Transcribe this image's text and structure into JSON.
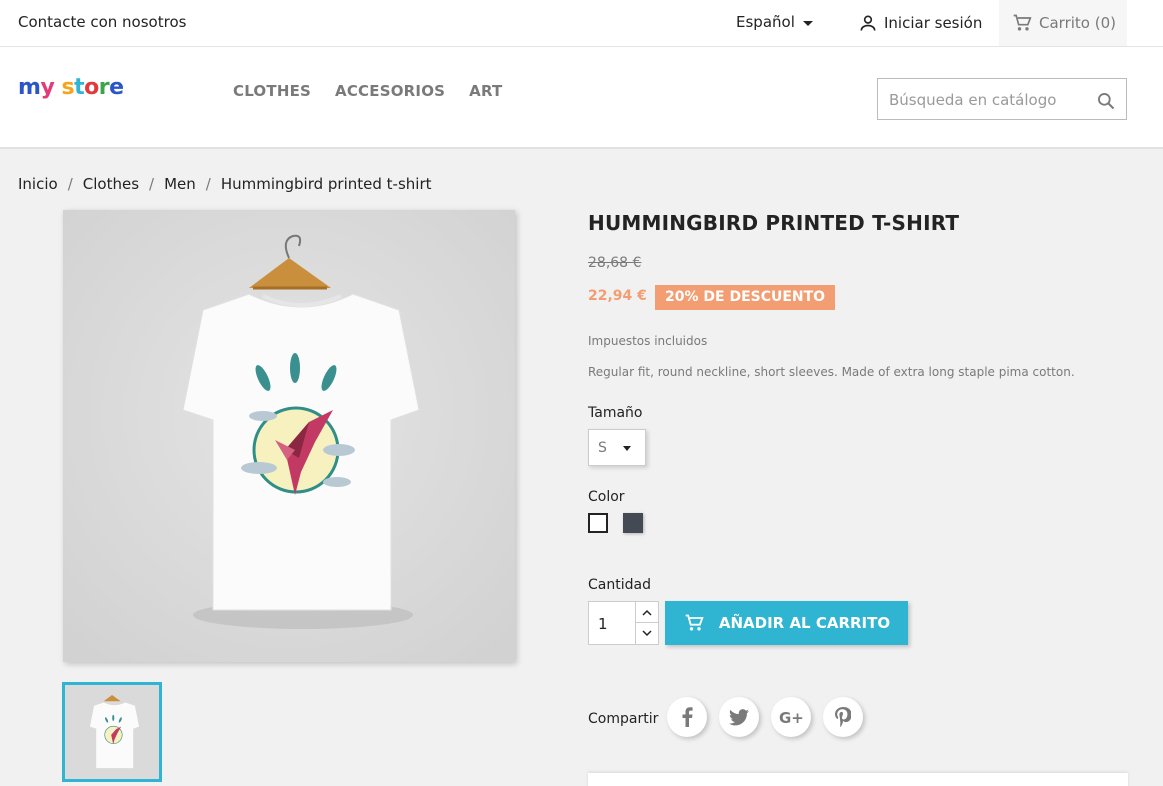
{
  "topbar": {
    "contact": "Contacte con nosotros",
    "language": "Español",
    "login": "Iniciar sesión",
    "cart": "Carrito (0)"
  },
  "header": {
    "logo": {
      "letters": [
        "m",
        "y",
        " ",
        "s",
        "t",
        "o",
        "r",
        "e"
      ],
      "colors": [
        "#2b56c7",
        "#e23a7a",
        "#ffffff",
        "#f4a51c",
        "#2fb5d2",
        "#e23a3a",
        "#3aa64a",
        "#2b56c7"
      ]
    },
    "menu": [
      "CLOTHES",
      "ACCESORIOS",
      "ART"
    ],
    "search_placeholder": "Búsqueda en catálogo"
  },
  "breadcrumb": [
    "Inicio",
    "Clothes",
    "Men",
    "Hummingbird printed t-shirt"
  ],
  "product": {
    "title": "HUMMINGBIRD PRINTED T-SHIRT",
    "old_price": "28,68 €",
    "price": "22,94 €",
    "discount": "20% DE DESCUENTO",
    "taxes": "Impuestos incluidos",
    "description": "Regular fit, round neckline, short sleeves. Made of extra long staple pima cotton.",
    "size_label": "Tamaño",
    "size_value": "S",
    "color_label": "Color",
    "colors": [
      "#ffffff",
      "#434a54"
    ],
    "quantity_label": "Cantidad",
    "quantity": "1",
    "add_to_cart": "AÑADIR AL CARRITO",
    "share_label": "Compartir",
    "social": [
      "facebook",
      "twitter",
      "google-plus",
      "pinterest"
    ]
  },
  "accent_color": "#2fb5d2",
  "discount_color": "#f39d72"
}
